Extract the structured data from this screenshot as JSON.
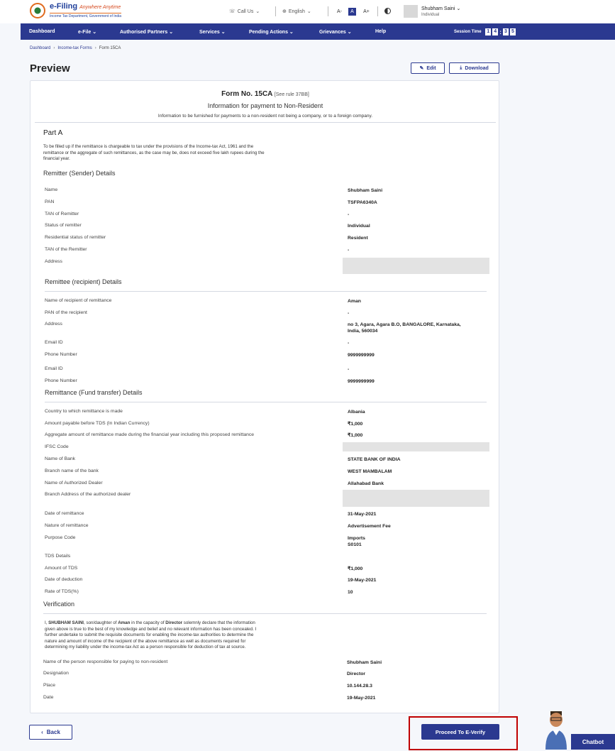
{
  "header": {
    "logo_title": "e-Filing",
    "logo_tag": "Anywhere Anytime",
    "logo_sub": "Income Tax Department, Government of India",
    "call_us": "Call Us",
    "language": "English",
    "font_small": "A-",
    "font_normal": "A",
    "font_large": "A+",
    "user_name": "Shubham Saini",
    "user_role": "Individual"
  },
  "nav": {
    "items": [
      "Dashboard",
      "e-File",
      "Authorised Partners",
      "Services",
      "Pending Actions",
      "Grievances",
      "Help"
    ],
    "session_label": "Session Time",
    "session_digits": [
      "1",
      "4",
      "3",
      "5"
    ]
  },
  "breadcrumb": [
    "Dashboard",
    "Income-tax Forms",
    "Form 15CA"
  ],
  "page_title": "Preview",
  "actions": {
    "edit": "Edit",
    "download": "Download"
  },
  "form": {
    "title": "Form No. 15CA",
    "rule": "[See rule 37BB]",
    "subtitle": "Information for payment to Non-Resident",
    "note": "Information to be furnished for payments to a non-resident not being a company, or to a foreign company.",
    "part": "Part A",
    "part_para": [
      "To be filled up if the remittance is chargeable to tax under the provisions of the Income-tax Act, 1961 and the",
      "remittance or the aggregate of such remittances, as the case may be, does not exceed five lakh rupees during the",
      "financial year."
    ]
  },
  "remitter": {
    "heading": "Remitter (Sender) Details",
    "rows": [
      {
        "label": "Name",
        "value": "Shubham Saini"
      },
      {
        "label": "PAN",
        "value": "TSFPA6340A"
      },
      {
        "label": "TAN of Remitter",
        "value": "-"
      },
      {
        "label": "Status of remitter",
        "value": "Individual"
      },
      {
        "label": "Residential status of remitter",
        "value": "Resident"
      },
      {
        "label": "TAN of the Remitter",
        "value": "-"
      },
      {
        "label": "Address",
        "value": ""
      }
    ]
  },
  "remittee": {
    "heading": "Remittee (recipient) Details",
    "rows": [
      {
        "label": "Name of recipient of remittance",
        "value": "Aman"
      },
      {
        "label": "PAN of the recipient",
        "value": "-"
      },
      {
        "label": "Address",
        "value": "no 3, Agara, Agara B.O, BANGALORE, Karnataka,",
        "value2": "India, 560034"
      },
      {
        "label": "Email ID",
        "value": "-"
      },
      {
        "label": "Phone Number",
        "value": "9999999999"
      },
      {
        "label": "Email ID",
        "value": "-"
      },
      {
        "label": "Phone Number",
        "value": "9999999999"
      }
    ]
  },
  "remittance": {
    "heading": "Remittance (Fund transfer) Details",
    "rows": [
      {
        "label": "Country to which remittance is made",
        "value": "Albania"
      },
      {
        "label": "Amount payable before TDS (In Indian Currency)",
        "value": "₹1,000"
      },
      {
        "label": "Aggregate amount of remittance made during the financial year including this proposed remittance",
        "value": "₹1,000"
      },
      {
        "label": "IFSC Code",
        "value": ""
      },
      {
        "label": "Name of Bank",
        "value": "STATE BANK OF INDIA"
      },
      {
        "label": "Branch name of the bank",
        "value": "WEST MAMBALAM"
      },
      {
        "label": "Name of Authorized Dealer",
        "value": "Allahabad Bank"
      },
      {
        "label": "Branch Address of the authorized dealer",
        "value": ""
      },
      {
        "label": "Date of remittance",
        "value": "31-May-2021"
      },
      {
        "label": "Nature of remittance",
        "value": "Advertisement Fee"
      },
      {
        "label": "Purpose Code",
        "value": "Imports",
        "value2": "S0101"
      },
      {
        "label": "TDS Details",
        "value": ""
      },
      {
        "label": "Amount of TDS",
        "value": "₹1,000"
      },
      {
        "label": "Date of deduction",
        "value": "19-May-2021"
      },
      {
        "label": "Rate of TDS(%)",
        "value": "10"
      }
    ]
  },
  "verification": {
    "heading": "Verification",
    "para_pre": "I, ",
    "para_name": "SHUBHAM SAINI",
    "para_mid": ", son/daughter of ",
    "para_parent": "Aman",
    "para_mid2": " in the capacity of ",
    "para_cap": "Director",
    "para_post": " solemnly declare that the information",
    "para_lines": [
      "given above is true to the best of my knowledge and belief and no relevant information has been concealed. I",
      "further undertake to submit the requisite documents for enabling the income-tax authorities to determine the",
      "nature and amount of income of the recipient of the above remittance as well as documents required for",
      "determining my liability under the income-tax Act as a person responsible for deduction of tax at source."
    ],
    "rows": [
      {
        "label": "Name of the person responsible for paying to non-resident",
        "value": "Shubham Saini"
      },
      {
        "label": "Designation",
        "value": "Director"
      },
      {
        "label": "Place",
        "value": "10.144.28.3"
      },
      {
        "label": "Date",
        "value": "19-May-2021"
      }
    ]
  },
  "footer": {
    "back": "Back",
    "proceed": "Proceed To E-Verify",
    "chatbot": "Chatbot"
  },
  "colors": {
    "primary": "#2b3990",
    "highlight": "#c00000"
  }
}
